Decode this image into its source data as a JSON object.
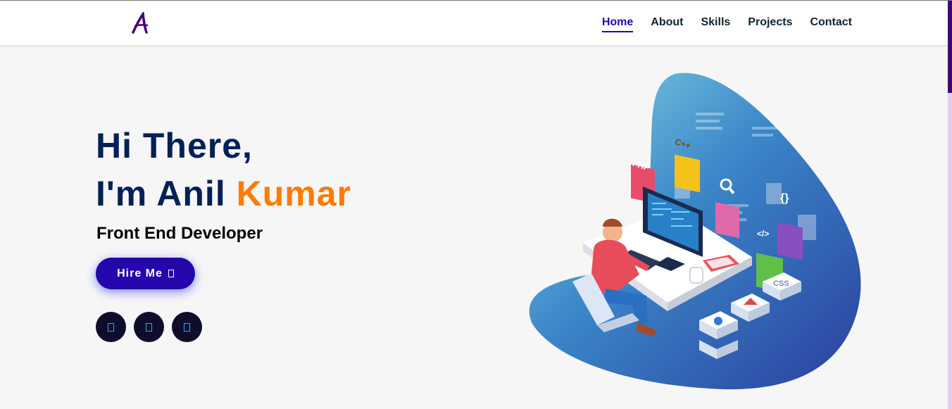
{
  "header": {
    "logo_letter": "A",
    "nav": [
      {
        "label": "Home",
        "active": true
      },
      {
        "label": "About",
        "active": false
      },
      {
        "label": "Skills",
        "active": false
      },
      {
        "label": "Projects",
        "active": false
      },
      {
        "label": "Contact",
        "active": false
      }
    ]
  },
  "hero": {
    "greeting": "Hi There,",
    "intro": "I'm Anil ",
    "highlight": "Kumar",
    "role": "Front End Developer",
    "cta_label": "Hire Me",
    "cta_icon": "arrow-icon",
    "socials": [
      "social-icon-1",
      "social-icon-2",
      "social-icon-3"
    ]
  },
  "illustration": {
    "badges": [
      "PHP",
      "C++",
      "{}",
      "</>",
      "CSS"
    ]
  },
  "colors": {
    "brand": "#2506ad",
    "heading": "#002057",
    "accent": "#ff7b00",
    "scroll_thumb": "#420177"
  }
}
